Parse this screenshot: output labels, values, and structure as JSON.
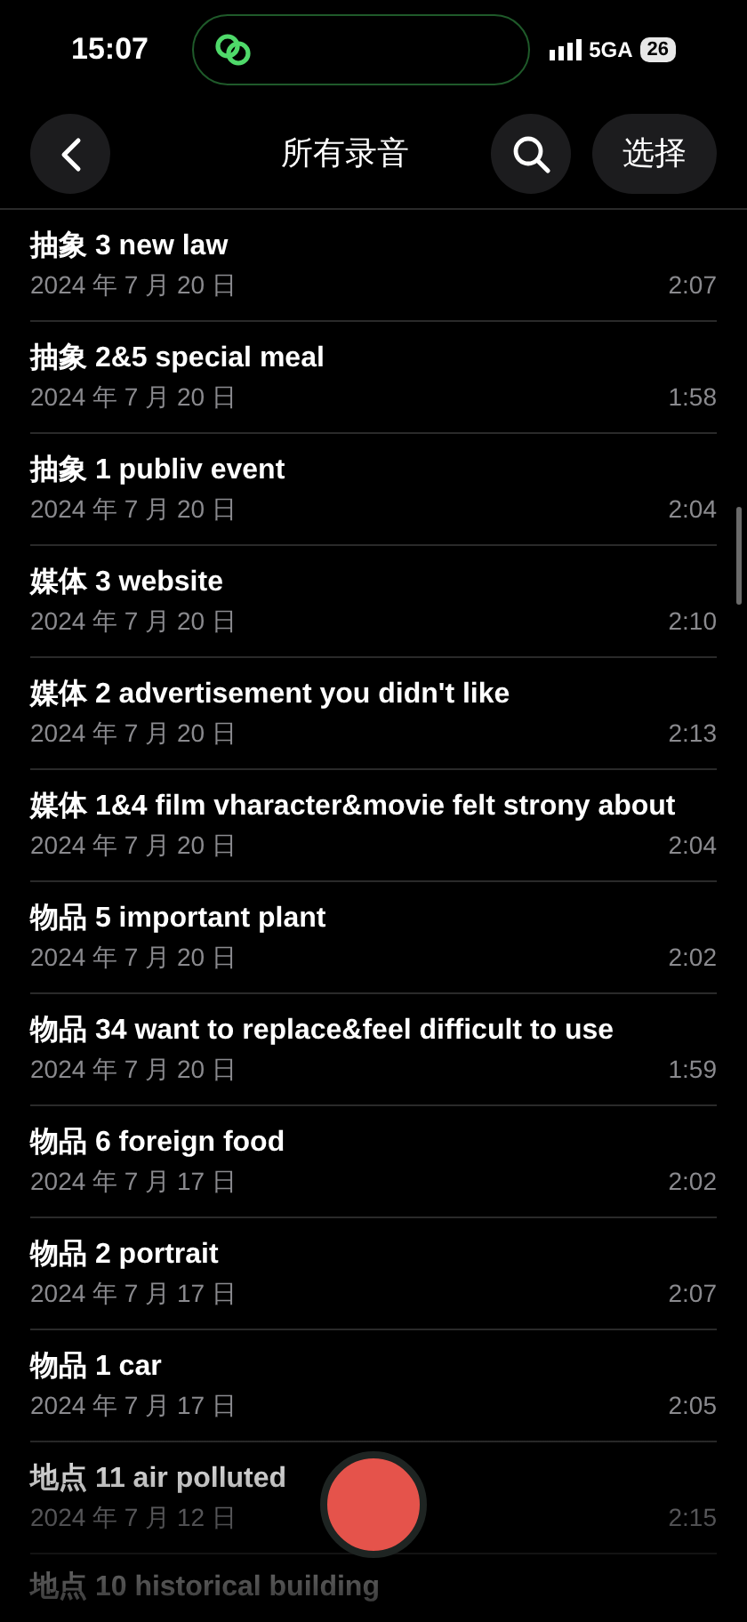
{
  "status_bar": {
    "time": "15:07",
    "network": "5GA",
    "battery": "26"
  },
  "header": {
    "title": "所有录音",
    "select_button": "选择"
  },
  "recordings": [
    {
      "title": "抽象 3 new law",
      "date": "2024 年 7 月 20 日",
      "duration": "2:07"
    },
    {
      "title": "抽象 2&5 special meal",
      "date": "2024 年 7 月 20 日",
      "duration": "1:58"
    },
    {
      "title": "抽象 1 publiv event",
      "date": "2024 年 7 月 20 日",
      "duration": "2:04"
    },
    {
      "title": "媒体 3 website",
      "date": "2024 年 7 月 20 日",
      "duration": "2:10"
    },
    {
      "title": "媒体 2 advertisement you didn't like",
      "date": "2024 年 7 月 20 日",
      "duration": "2:13"
    },
    {
      "title": "媒体 1&4 film vharacter&movie felt strony about",
      "date": "2024 年 7 月 20 日",
      "duration": "2:04"
    },
    {
      "title": "物品 5 important plant",
      "date": "2024 年 7 月 20 日",
      "duration": "2:02"
    },
    {
      "title": "物品 34 want to replace&feel difficult to use",
      "date": "2024 年 7 月 20 日",
      "duration": "1:59"
    },
    {
      "title": "物品 6 foreign food",
      "date": "2024 年 7 月 17 日",
      "duration": "2:02"
    },
    {
      "title": "物品 2 portrait",
      "date": "2024 年 7 月 17 日",
      "duration": "2:07"
    },
    {
      "title": "物品 1 car",
      "date": "2024 年 7 月 17 日",
      "duration": "2:05"
    },
    {
      "title": "地点 11 air polluted",
      "date": "2024 年 7 月 12 日",
      "duration": "2:15"
    },
    {
      "title": "地点 10 historical building"
    }
  ]
}
